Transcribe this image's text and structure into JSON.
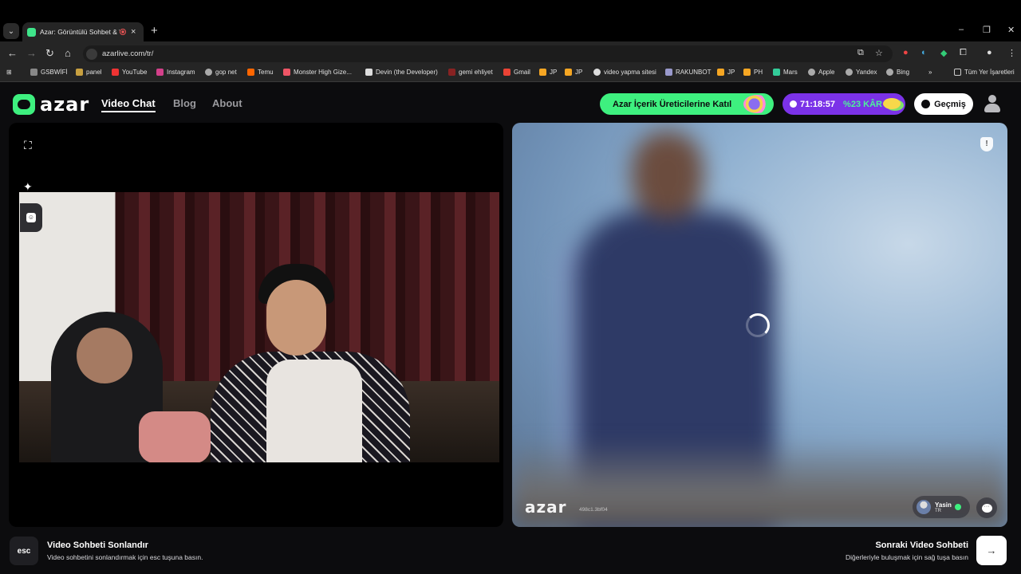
{
  "browser": {
    "tab_title": "Azar: Görüntülü Sohbet & V",
    "tab_close": "×",
    "new_tab": "+",
    "url": "azarlive.com/tr/",
    "window_controls": [
      "–",
      "❐",
      "✕"
    ],
    "bookmarks": [
      "GSBWİFİ",
      "panel",
      "YouTube",
      "Instagram",
      "gop net",
      "Temu",
      "Monster High Gize...",
      "Devin (the Developer)",
      "gemi ehliyet",
      "Gmail",
      "JP",
      "JP",
      "video yapma sitesi",
      "RAKUNBOT",
      "JP",
      "PH",
      "Mars",
      "Apple",
      "Yandex",
      "Bing"
    ],
    "bookmarks_more": "»",
    "all_bookmarks": "Tüm Yer İşaretleri"
  },
  "header": {
    "logo_text": "azar",
    "nav": [
      "Video Chat",
      "Blog",
      "About"
    ],
    "creator_button": "Azar İçerik Üreticilerine Katıl",
    "timer": "71:18:57",
    "discount": "%23 KÂR",
    "history_button": "Geçmiş"
  },
  "remote": {
    "watermark": "azar",
    "watermark_id": "498c1.3bf04",
    "peer_name": "Yasin",
    "peer_country": "TR"
  },
  "footer": {
    "esc_key": "esc",
    "end_title": "Video Sohbeti Sonlandır",
    "end_sub": "Video sohbetini sonlandırmak için esc tuşuna basın.",
    "next_title": "Sonraki Video Sohbeti",
    "next_sub": "Diğerleriyle buluşmak için sağ tuşa basın"
  },
  "colors": {
    "accent_green": "#3ef07f",
    "promo_purple": "#7b32e8",
    "background": "#0c0c0e"
  }
}
